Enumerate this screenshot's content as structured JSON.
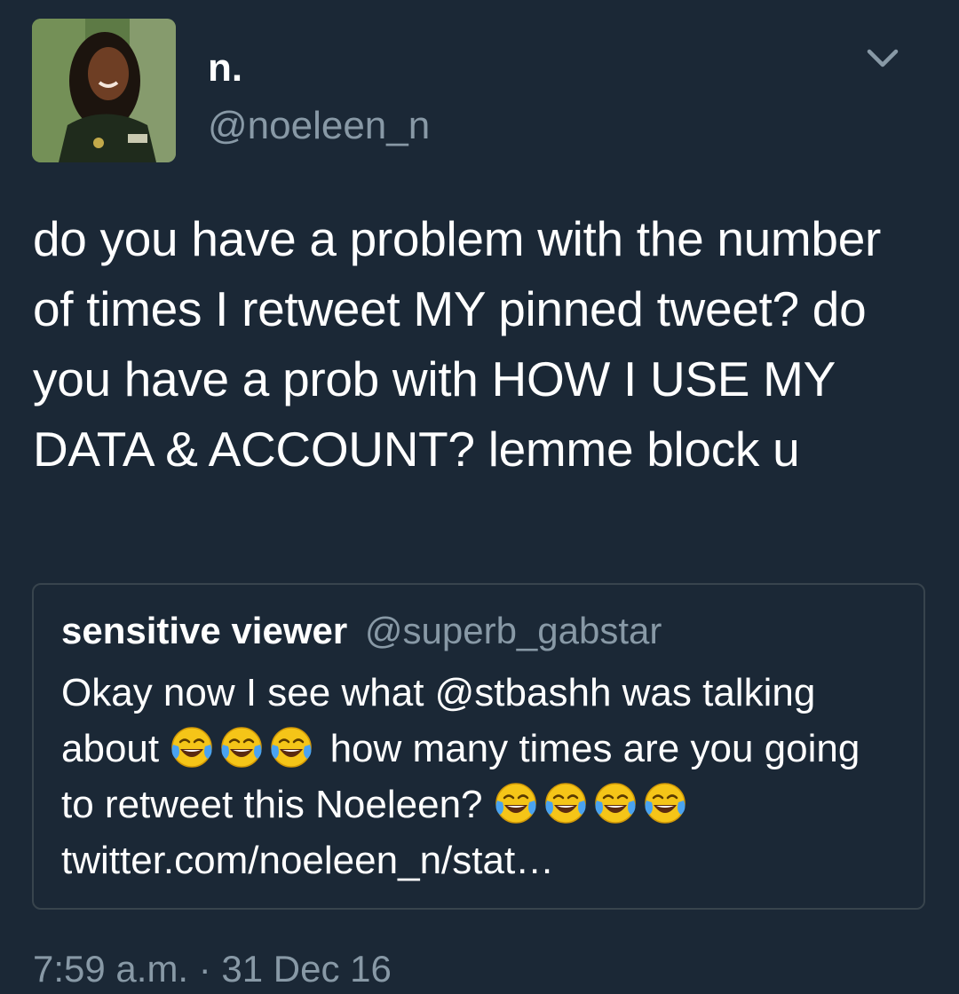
{
  "author": {
    "display_name": "n.",
    "handle": "@noeleen_n",
    "avatar_icon": "profile-photo"
  },
  "tweet": {
    "text": "do you have a problem with the number of times I retweet MY pinned tweet? do you have a prob with HOW I USE MY DATA & ACCOUNT? lemme block u",
    "timestamp": "7:59 a.m. · 31 Dec 16"
  },
  "quoted_tweet": {
    "display_name": "sensitive viewer",
    "handle": "@superb_gabstar",
    "text_part1": "Okay now I see what @stbashh was talking about ",
    "text_part2": " how many times are you going to retweet this Noeleen? ",
    "text_part3": " twitter.com/noeleen_n/stat…",
    "emoji_icon": "face-with-tears-of-joy"
  },
  "menu": {
    "icon": "chevron-down-icon"
  },
  "colors": {
    "background": "#1b2836",
    "text_primary": "#ffffff",
    "text_secondary": "#8899a6",
    "card_border": "#38444d"
  }
}
